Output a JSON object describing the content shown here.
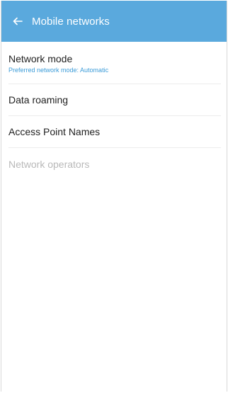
{
  "colors": {
    "app_bar": "#5aa9dd",
    "accent": "#3a9bd8",
    "title_text": "#222222",
    "disabled_text": "#b9b9b9"
  },
  "header": {
    "back_icon": "arrow-left-icon",
    "title": "Mobile networks"
  },
  "items": [
    {
      "title": "Network mode",
      "subtitle": "Preferred network mode: Automatic",
      "enabled": true
    },
    {
      "title": "Data roaming",
      "enabled": true
    },
    {
      "title": "Access Point Names",
      "enabled": true
    },
    {
      "title": "Network operators",
      "enabled": false
    }
  ]
}
